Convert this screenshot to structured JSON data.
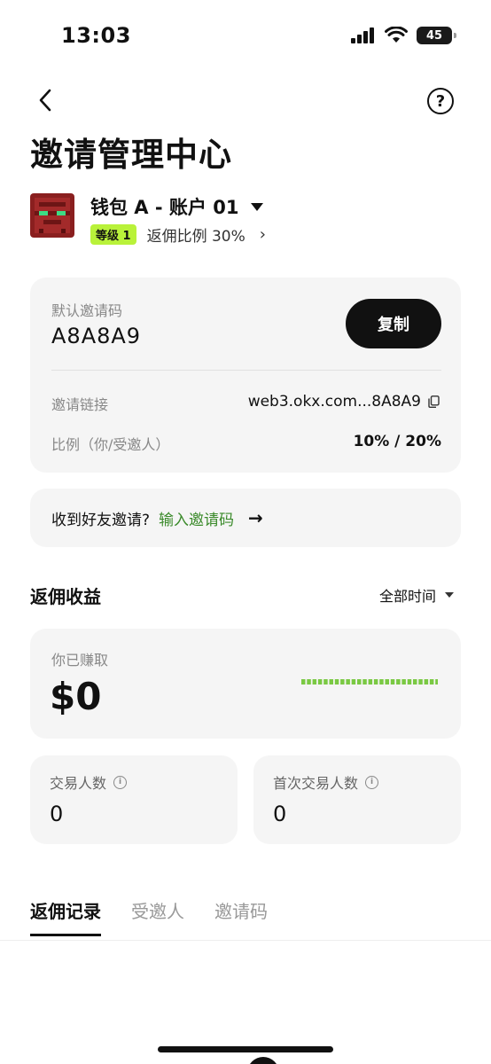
{
  "status_bar": {
    "time": "13:03",
    "battery": "45"
  },
  "header": {
    "title": "邀请管理中心",
    "back_icon": "chevron-left-icon",
    "help_icon": "question-circle-icon"
  },
  "wallet": {
    "name": "钱包 A - 账户 01",
    "level": "等级 1",
    "rebate_ratio": "返佣比例 30%"
  },
  "invite_card": {
    "code_label": "默认邀请码",
    "code": "A8A8A9",
    "copy_label": "复制",
    "link_label": "邀请链接",
    "link_value": "web3.okx.com...8A8A9",
    "ratio_label": "比例（你/受邀人）",
    "ratio_value": "10% / 20%"
  },
  "friend_invite": {
    "prompt": "收到好友邀请?",
    "link": "输入邀请码"
  },
  "earnings": {
    "section_title": "返佣收益",
    "time_filter": "全部时间",
    "earned_label": "你已赚取",
    "earned_value": "$0",
    "accent_color": "#7ac943"
  },
  "stats": [
    {
      "label": "交易人数",
      "value": "0"
    },
    {
      "label": "首次交易人数",
      "value": "0"
    }
  ],
  "tabs": [
    {
      "label": "返佣记录",
      "active": true
    },
    {
      "label": "受邀人",
      "active": false
    },
    {
      "label": "邀请码",
      "active": false
    }
  ]
}
